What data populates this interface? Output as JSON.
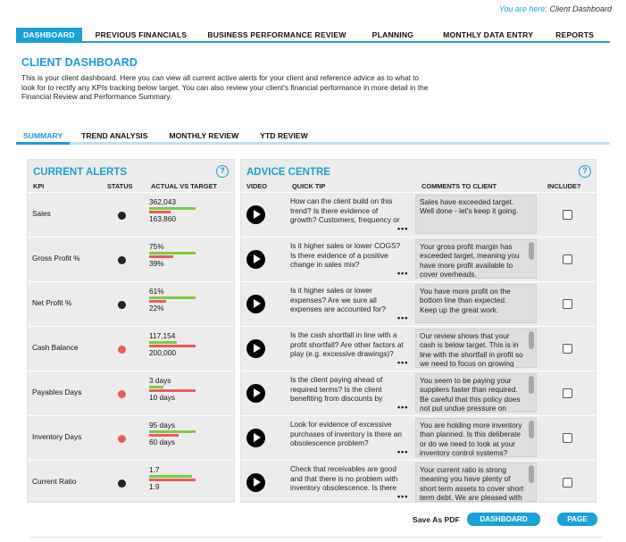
{
  "breadcrumb": {
    "prefix": "You are here:",
    "current": "Client Dashboard"
  },
  "top_nav": [
    "DASHBOARD",
    "PREVIOUS FINANCIALS",
    "BUSINESS PERFORMANCE REVIEW",
    "PLANNING",
    "MONTHLY DATA ENTRY",
    "REPORTS"
  ],
  "page": {
    "title": "CLIENT DASHBOARD",
    "intro": "This is your client dashboard. Here you can view all current active alerts for your client and reference advice as to what to look for to rectify any KPIs tracking below target. You can also review your client's financial performance in more detail in the Financial Review and Performance Summary."
  },
  "sub_nav": [
    "SUMMARY",
    "TREND ANALYSIS",
    "MONTHLY REVIEW",
    "YTD REVIEW"
  ],
  "alerts": {
    "title": "CURRENT ALERTS",
    "help": "?",
    "headers": {
      "kpi": "KPI",
      "status": "STATUS",
      "actual_vs_target": "ACTUAL VS TARGET"
    },
    "rows": [
      {
        "kpi": "Sales",
        "status_color": "#222222",
        "actual": "362,043",
        "target": "163,860",
        "actual_frac": 0.93,
        "target_frac": 0.42
      },
      {
        "kpi": "Gross Profit %",
        "status_color": "#222222",
        "actual": "75%",
        "target": "39%",
        "actual_frac": 0.93,
        "target_frac": 0.48
      },
      {
        "kpi": "Net Profit %",
        "status_color": "#222222",
        "actual": "61%",
        "target": "22%",
        "actual_frac": 0.93,
        "target_frac": 0.34
      },
      {
        "kpi": "Cash Balance",
        "status_color": "#ee5a5a",
        "actual": "117,154",
        "target": "200,000",
        "actual_frac": 0.55,
        "target_frac": 0.93
      },
      {
        "kpi": "Payables Days",
        "status_color": "#ee5a5a",
        "actual": "3 days",
        "target": "10 days",
        "actual_frac": 0.28,
        "target_frac": 0.93
      },
      {
        "kpi": "Inventory Days",
        "status_color": "#ee5a5a",
        "actual": "95 days",
        "target": "60 days",
        "actual_frac": 0.93,
        "target_frac": 0.59
      },
      {
        "kpi": "Current Ratio",
        "status_color": "#222222",
        "actual": "1.7",
        "target": "1.9",
        "actual_frac": 0.85,
        "target_frac": 0.93
      }
    ]
  },
  "advice": {
    "title": "ADVICE CENTRE",
    "help": "?",
    "headers": {
      "video": "VIDEO",
      "quick_tip": "QUICK TIP",
      "comments": "COMMENTS TO CLIENT",
      "include": "INCLUDE?"
    },
    "more": "•••",
    "rows": [
      {
        "tip": "How can the client build on this trend? Is there evidence of growth? Customers, frequency or transaction value?",
        "comment": "Sales have exceeded target. Well done - let's keep it going.",
        "has_scroll": false
      },
      {
        "tip": "Is it higher sales or lower COGS? Is there evidence of a positive change in sales mix?",
        "comment": "Your gross profit margin has exceeded target, meaning you have more profit available to cover overheads.",
        "has_scroll": true
      },
      {
        "tip": "Is it higher sales or lower expenses? Are we sure all expenses are accounted for?",
        "comment": "You have more profit on the bottom line than expected. Keep up the great work.",
        "has_scroll": false
      },
      {
        "tip": "Is the cash shortfall in line with a profit shortfall? Are other factors at play (e.g. excessive drawings)?",
        "comment": "Our review shows that your cash is below target. This is in line with the shortfall in profit so we need to focus on growing profit.",
        "has_scroll": true
      },
      {
        "tip": "Is the client paying ahead of required terms? Is the client benefiting from discounts by paying early?",
        "comment": "You seem to be paying your suppliers faster than required. Be careful that this policy does not put undue pressure on cash.",
        "has_scroll": true
      },
      {
        "tip": "Look for evidence of excessive purchases of inventory Is there an obsolescence problem?",
        "comment": "You are holding more inventory than planned. Is this deliberate or do we need to look at your inventory control systems?",
        "has_scroll": true
      },
      {
        "tip": "Check that receivables are good and that there is no problem with inventory obsolescence. Is there an issue?",
        "comment": "Your current ratio is strong meaning you have plenty of short term assets to cover short term debt. We are pleased with this result.",
        "has_scroll": true
      }
    ]
  },
  "footer": {
    "save_pdf": "Save As PDF",
    "dashboard_btn": "DASHBOARD",
    "page_btn": "PAGE"
  },
  "colors": {
    "accent": "#1aa1d8",
    "bar_actual": "#7ccc3f",
    "bar_target": "#ee5a5a",
    "panel_bg": "#ececec"
  }
}
